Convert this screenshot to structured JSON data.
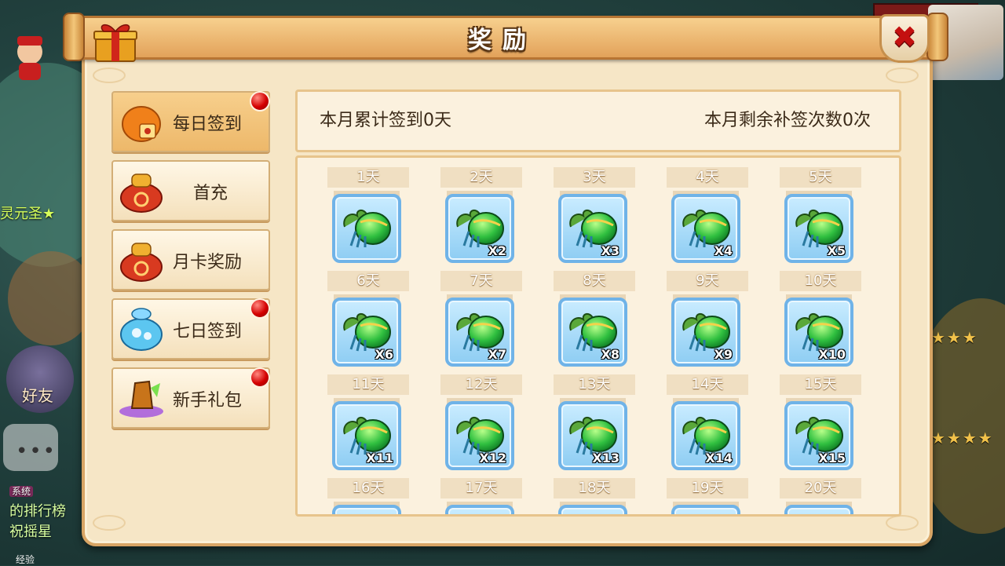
{
  "dialog": {
    "title": "奖励",
    "close_label": "✖"
  },
  "sidebar": {
    "items": [
      {
        "label": "每日签到",
        "icon": "lucky-bag-orange-icon",
        "active": true,
        "has_notification": true
      },
      {
        "label": "首充",
        "icon": "money-bag-icon",
        "active": false,
        "has_notification": false
      },
      {
        "label": "月卡奖励",
        "icon": "money-bag-icon",
        "active": false,
        "has_notification": false
      },
      {
        "label": "七日签到",
        "icon": "blue-gem-bag-icon",
        "active": false,
        "has_notification": true
      },
      {
        "label": "新手礼包",
        "icon": "crystal-gift-icon",
        "active": false,
        "has_notification": true
      }
    ]
  },
  "info": {
    "signed_text": "本月累计签到0天",
    "remaining_text": "本月剩余补签次数0次"
  },
  "days": [
    {
      "label": "1天",
      "qty": ""
    },
    {
      "label": "2天",
      "qty": "X2"
    },
    {
      "label": "3天",
      "qty": "X3"
    },
    {
      "label": "4天",
      "qty": "X4"
    },
    {
      "label": "5天",
      "qty": "X5"
    },
    {
      "label": "6天",
      "qty": "X6"
    },
    {
      "label": "7天",
      "qty": "X7"
    },
    {
      "label": "8天",
      "qty": "X8"
    },
    {
      "label": "9天",
      "qty": "X9"
    },
    {
      "label": "10天",
      "qty": "X10"
    },
    {
      "label": "11天",
      "qty": "X11"
    },
    {
      "label": "12天",
      "qty": "X12"
    },
    {
      "label": "13天",
      "qty": "X13"
    },
    {
      "label": "14天",
      "qty": "X14"
    },
    {
      "label": "15天",
      "qty": "X15"
    },
    {
      "label": "16天",
      "qty": ""
    },
    {
      "label": "17天",
      "qty": ""
    },
    {
      "label": "18天",
      "qty": ""
    },
    {
      "label": "19天",
      "qty": ""
    },
    {
      "label": "20天",
      "qty": ""
    }
  ],
  "background": {
    "friend_label": "好友",
    "title_text": "灵元圣★",
    "ticker_tag": "系统",
    "ticker_lines": [
      "的排行榜",
      "祝摇星"
    ],
    "bottom_text": "经验"
  },
  "colors": {
    "panel_bg": "#f6e6c6",
    "panel_border": "#d8a565",
    "item_frame": "#6fb3e8",
    "notification_red": "#d40000"
  }
}
